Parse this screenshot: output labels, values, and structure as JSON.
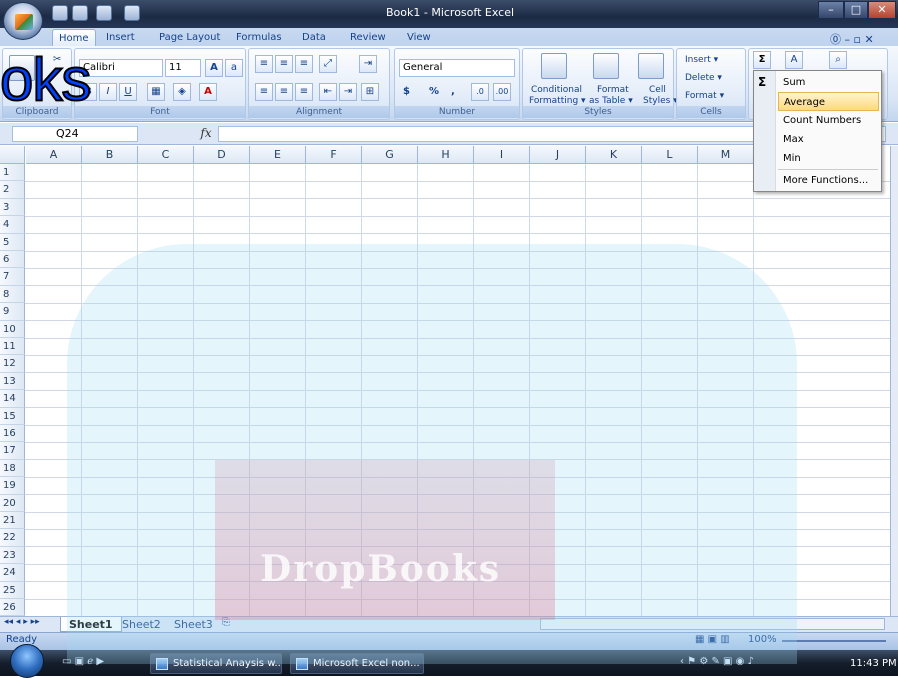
{
  "window": {
    "title": "Book1 - Microsoft Excel"
  },
  "tabs": [
    "Home",
    "Insert",
    "Page Layout",
    "Formulas",
    "Data",
    "Review",
    "View"
  ],
  "ribbon": {
    "clipboard_label": "Clipboard",
    "font": {
      "name": "Calibri",
      "size": "11",
      "label": "Font"
    },
    "alignment_label": "Alignment",
    "number": {
      "format": "General",
      "currency": "$",
      "percent": "%",
      "comma": ",",
      "label": "Number"
    },
    "styles": {
      "conditional": "Conditional",
      "conditional2": "Formatting ▾",
      "format_as": "Format",
      "format_as2": "as Table ▾",
      "cell": "Cell",
      "cell2": "Styles ▾",
      "label": "Styles"
    },
    "cells": {
      "insert": "Insert ▾",
      "delete": "Delete ▾",
      "format": "Format ▾",
      "label": "Cells"
    }
  },
  "formula_bar": {
    "name_box": "Q24",
    "fx": "fx",
    "value": ""
  },
  "columns": [
    "A",
    "B",
    "C",
    "D",
    "E",
    "F",
    "G",
    "H",
    "I",
    "J",
    "K",
    "L",
    "M"
  ],
  "rows": [
    "1",
    "2",
    "3",
    "4",
    "5",
    "6",
    "7",
    "8",
    "9",
    "10",
    "11",
    "12",
    "13",
    "14",
    "15",
    "16",
    "17",
    "18",
    "19",
    "20",
    "21",
    "22",
    "23",
    "24",
    "25",
    "26"
  ],
  "sheets": [
    "Sheet1",
    "Sheet2",
    "Sheet3"
  ],
  "status": {
    "ready": "Ready",
    "zoom": "100%"
  },
  "autosum_menu": {
    "sigma": "Σ",
    "items": [
      "Sum",
      "Average",
      "Count Numbers",
      "Max",
      "Min",
      "More Functions..."
    ],
    "highlighted": "Average"
  },
  "taskbar": {
    "items": [
      "Statistical Anaysis w...",
      "Microsoft Excel non..."
    ],
    "clock": "11:43 PM"
  },
  "overlay": {
    "big_text": "oks",
    "watermark": "DropBooks"
  }
}
